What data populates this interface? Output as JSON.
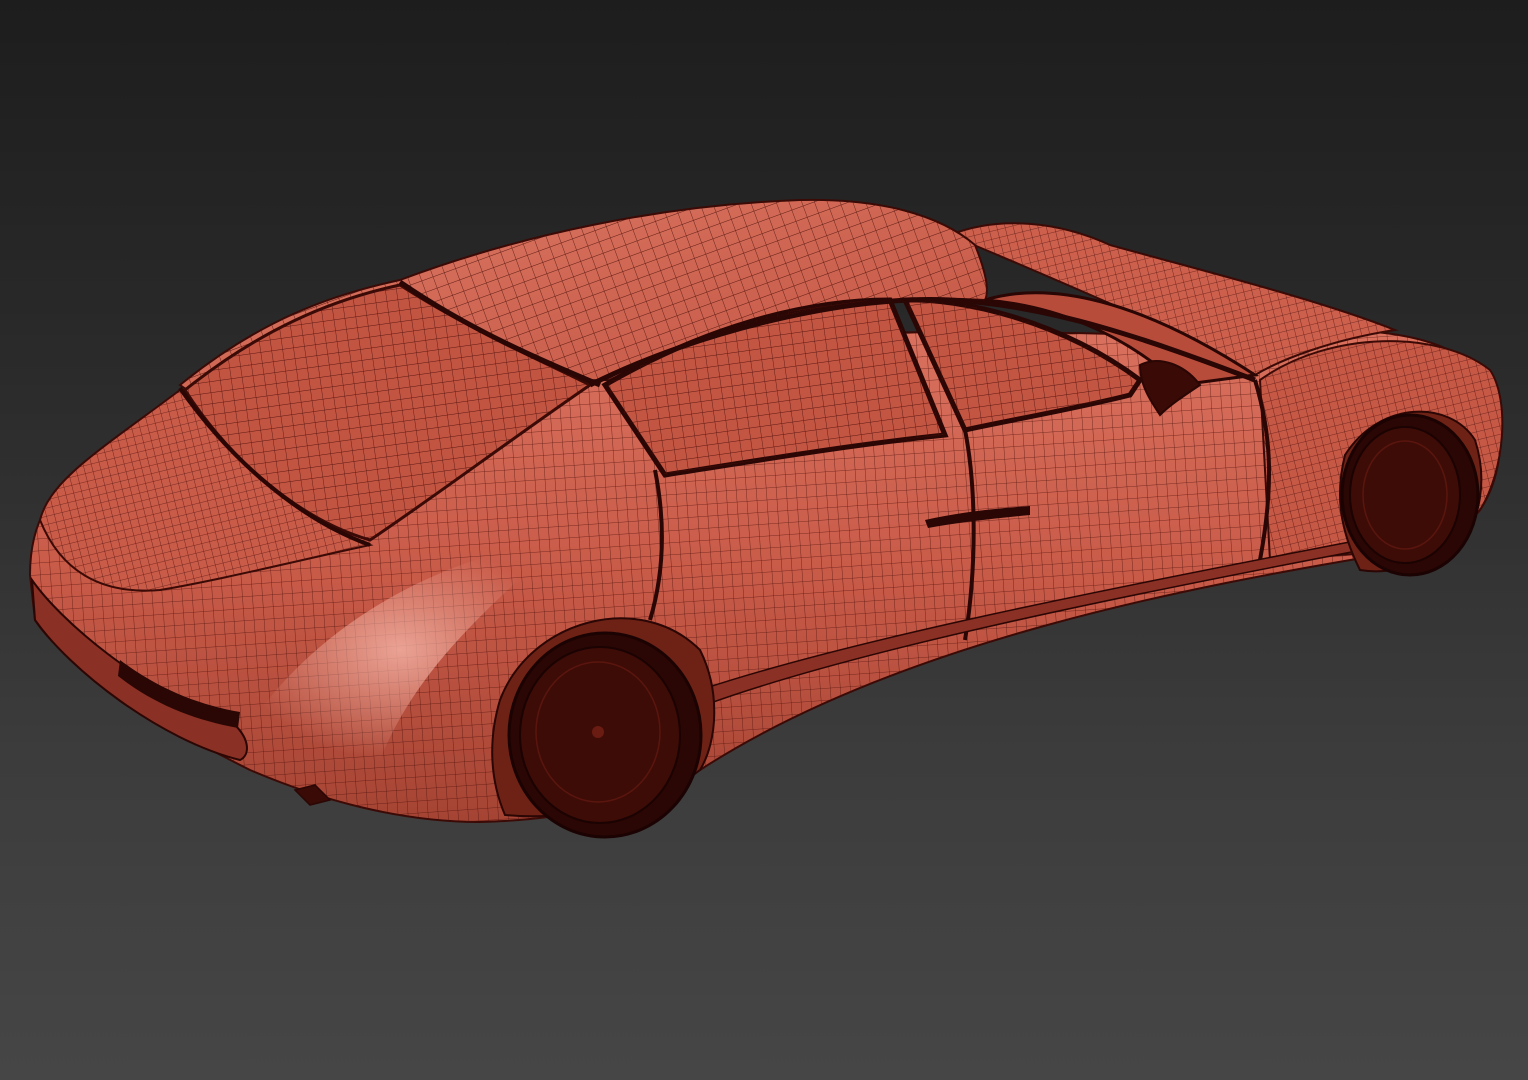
{
  "viewport": {
    "background_top": "#1d1d1d",
    "background_bottom": "#464646"
  },
  "model": {
    "subject": "car-wireframe",
    "shading": "flat-red-with-wire-overlay",
    "surface_color": "#c85a48",
    "surface_highlight": "#e08a78",
    "surface_shadow": "#8a3024",
    "wire_color": "#4a0e08",
    "opening_color": "#2a0604"
  }
}
